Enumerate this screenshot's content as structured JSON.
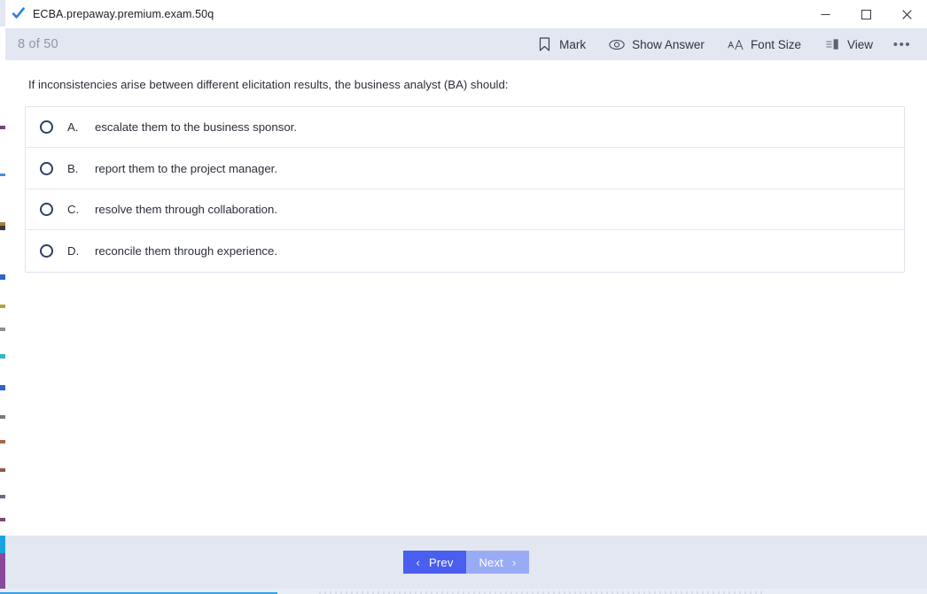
{
  "window": {
    "title": "ECBA.prepaway.premium.exam.50q",
    "app_icon": "blue-check-icon",
    "controls": {
      "minimize": "─",
      "maximize": "☐",
      "close": "✕"
    }
  },
  "toolbar": {
    "counter": "8 of 50",
    "current_question": 8,
    "total_questions": 50,
    "actions": [
      {
        "id": "mark",
        "label": "Mark",
        "icon": "bookmark-icon"
      },
      {
        "id": "show-answer",
        "label": "Show Answer",
        "icon": "eye-icon"
      },
      {
        "id": "font-size",
        "label": "Font Size",
        "icon": "font-size-aa-icon"
      },
      {
        "id": "view",
        "label": "View",
        "icon": "layout-panel-icon"
      }
    ],
    "more_label": "•••"
  },
  "question": {
    "text": "If inconsistencies arise between different elicitation results, the business analyst (BA) should:",
    "options": [
      {
        "letter": "A.",
        "text": "escalate them to the business sponsor.",
        "selected": false
      },
      {
        "letter": "B.",
        "text": "report them to the project manager.",
        "selected": false
      },
      {
        "letter": "C.",
        "text": "resolve them through collaboration.",
        "selected": false
      },
      {
        "letter": "D.",
        "text": "reconcile them through experience.",
        "selected": false
      }
    ]
  },
  "footer": {
    "prev_label": "Prev",
    "next_label": "Next",
    "prev_chevron": "‹",
    "next_chevron": "›"
  },
  "colors": {
    "toolbar_bg": "#e3e7f2",
    "content_bg": "#ffffff",
    "prev_button": "#4a5ef0",
    "next_button": "#9aabf5",
    "radio_outline": "#2e3f66",
    "option_border": "#dfe3ec",
    "counter_text": "#8f96a8",
    "progress_bar": "#31a3e0"
  }
}
